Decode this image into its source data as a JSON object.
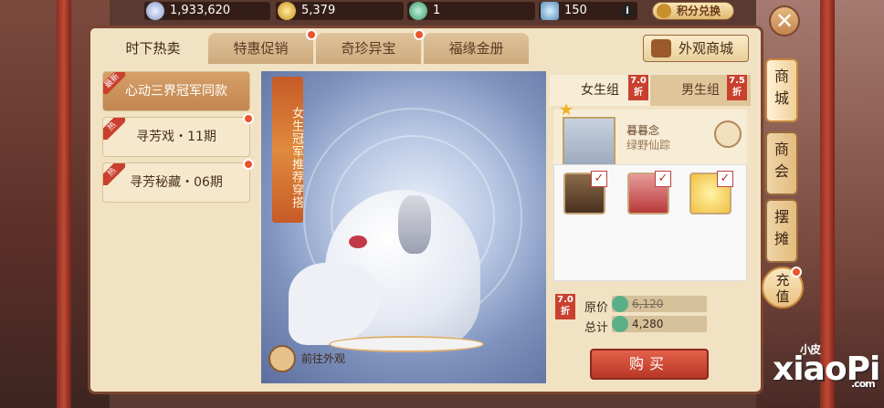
{
  "resources": {
    "silver": "1,933,620",
    "gold": "5,379",
    "jade": "1",
    "ticket": "150",
    "info_icon": "i",
    "exchange_label": "积分兑换"
  },
  "tabs": [
    {
      "label": "时下热卖"
    },
    {
      "label": "特惠促销"
    },
    {
      "label": "奇珍异宝"
    },
    {
      "label": "福缘金册"
    }
  ],
  "mall_button": "外观商城",
  "list": [
    {
      "label": "心动三界冠军同款",
      "badge": "最新"
    },
    {
      "label": "寻芳戏・11期",
      "badge": "热"
    },
    {
      "label": "寻芳秘藏・06期",
      "badge": "热"
    }
  ],
  "preview": {
    "banner": "女生冠军推荐穿搭",
    "goto_label": "前往外观"
  },
  "detail": {
    "female_tab": "女生组",
    "male_tab": "男生组",
    "female_discount": "7.0\n折",
    "male_discount": "7.5\n折",
    "char_name": "暮暮念",
    "char_title": "绿野仙踪",
    "price_discount": "7.0\n折",
    "original_label": "原价",
    "original_price": "6,120",
    "total_label": "总计",
    "total_price": "4,280",
    "buy_label": "购买"
  },
  "side_tabs": [
    {
      "label": "商城"
    },
    {
      "label": "商会"
    },
    {
      "label": "摆摊"
    }
  ],
  "recharge_label": "充值",
  "close_icon": "✕",
  "watermark": {
    "main": "xiaoPi",
    "top": "小皮",
    "suffix": ".com"
  }
}
